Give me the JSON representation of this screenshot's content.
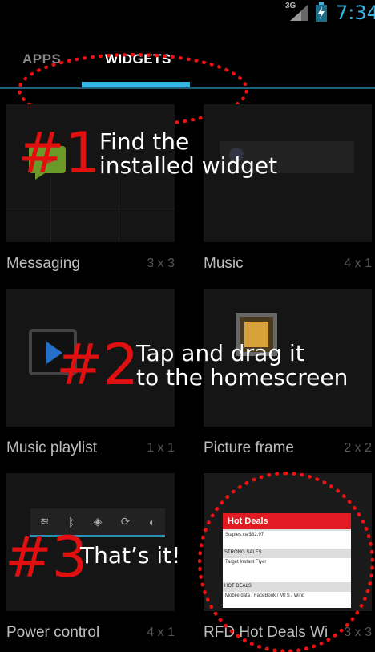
{
  "status_bar": {
    "network": "3G",
    "time": "7:34",
    "accent": "#33b5e5"
  },
  "tabs": [
    {
      "label": "APPS",
      "selected": false
    },
    {
      "label": "WIDGETS",
      "selected": true
    }
  ],
  "widgets": [
    {
      "label": "Messaging",
      "size": "3 x 3"
    },
    {
      "label": "Music",
      "size": "4 x 1"
    },
    {
      "label": "Music playlist",
      "size": "1 x 1"
    },
    {
      "label": "Picture frame",
      "size": "2 x 2"
    },
    {
      "label": "Power control",
      "size": "4 x 1"
    },
    {
      "label": "RFD Hot Deals Wi",
      "size": "3 x 3"
    }
  ],
  "rfd_preview": {
    "header": "Hot Deals",
    "section1": "STRONG SALES",
    "section2": "HOT DEALS",
    "items": [
      "Staples.ca $32.97",
      "Target Instant Flyer",
      "Mobile data / FaceBook / MTS / Wind"
    ]
  },
  "annotations": [
    {
      "number": "#1",
      "text": [
        "Find the",
        "installed widget"
      ]
    },
    {
      "number": "#2",
      "text": [
        "Tap and drag it",
        "to the homescreen"
      ]
    },
    {
      "number": "#3",
      "text": [
        "That’s it!"
      ]
    }
  ],
  "annotation_color": "#e01010"
}
